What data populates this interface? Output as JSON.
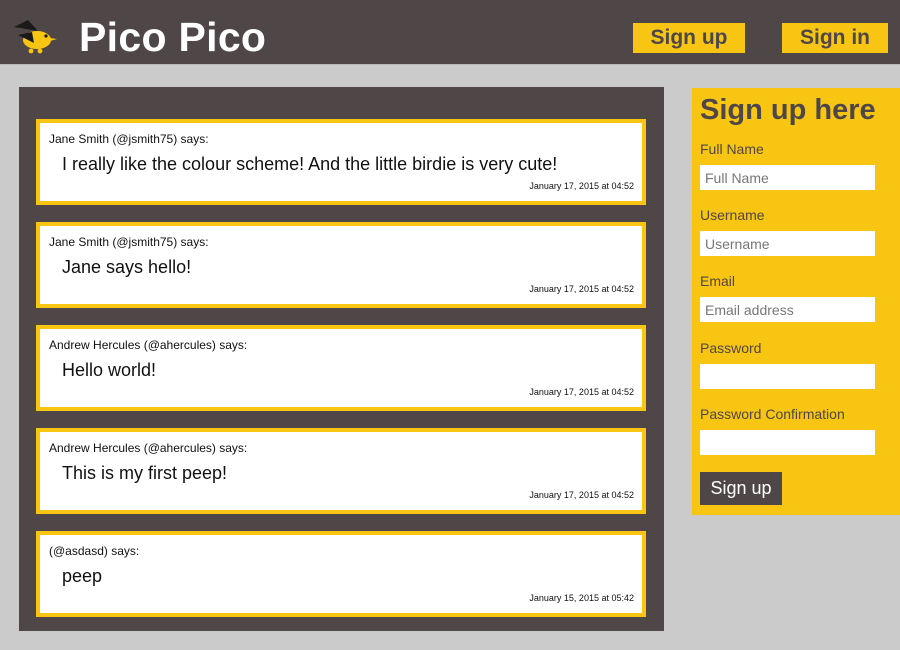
{
  "header": {
    "title": "Pico Pico",
    "logo_icon": "bird-icon",
    "signup_label": "Sign up",
    "signin_label": "Sign in"
  },
  "colors": {
    "accent": "#f9c513",
    "dark": "#4f4647",
    "background": "#cbcbcb"
  },
  "peeps": [
    {
      "author": "Jane Smith (@jsmith75) says:",
      "text": "I really like the colour scheme! And the little birdie is very cute!",
      "time": "January 17, 2015 at 04:52"
    },
    {
      "author": "Jane Smith (@jsmith75) says:",
      "text": "Jane says hello!",
      "time": "January 17, 2015 at 04:52"
    },
    {
      "author": "Andrew Hercules (@ahercules) says:",
      "text": "Hello world!",
      "time": "January 17, 2015 at 04:52"
    },
    {
      "author": "Andrew Hercules (@ahercules) says:",
      "text": "This is my first peep!",
      "time": "January 17, 2015 at 04:52"
    },
    {
      "author": "(@asdasd) says:",
      "text": "peep",
      "time": "January 15, 2015 at 05:42"
    }
  ],
  "signup": {
    "title": "Sign up here",
    "fields": [
      {
        "label": "Full Name",
        "placeholder": "Full Name",
        "value": ""
      },
      {
        "label": "Username",
        "placeholder": "Username",
        "value": ""
      },
      {
        "label": "Email",
        "placeholder": "Email address",
        "value": ""
      },
      {
        "label": "Password",
        "placeholder": "",
        "value": ""
      },
      {
        "label": "Password Confirmation",
        "placeholder": "",
        "value": ""
      }
    ],
    "submit_label": "Sign up"
  }
}
